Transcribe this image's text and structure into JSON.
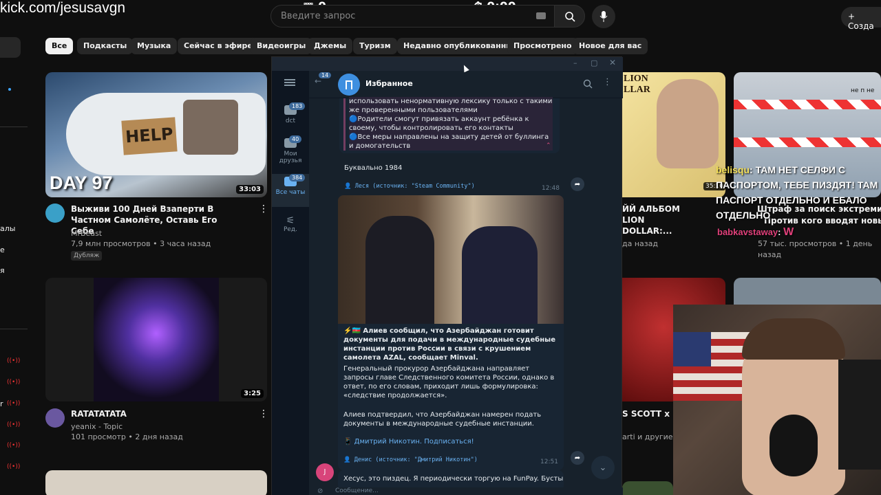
{
  "overlay": {
    "url": "kick.com/jesusavgn",
    "viewer_count": "0",
    "timer": "0:00"
  },
  "header": {
    "search_placeholder": "Введите запрос",
    "create_label": "Созда"
  },
  "chips": [
    "Все",
    "Подкасты",
    "Музыка",
    "Сейчас в эфире",
    "Видеоигры",
    "Джемы",
    "Туризм",
    "Недавно опубликованные",
    "Просмотрено",
    "Новое для вас"
  ],
  "sidebar_fragments": [
    "алы",
    "е",
    "я",
    "r"
  ],
  "videos": [
    {
      "thumb_text": "DAY 97",
      "thumb_sign": "HELP",
      "duration": "33:03",
      "title": "Выживи 100 Дней Взаперти В Частном Самолёте, Оставь Его Себе",
      "channel": "MrBeast",
      "stats": "7,9 млн просмотров • 3 часа назад",
      "badge": "Дубляж"
    },
    {
      "duration": "3:25",
      "title": "RATATATATA",
      "channel": "yeanix - Topic",
      "stats": "101 просмотр • 2 дня назад"
    },
    {
      "title": "ЙЙ АЛЬБОМ LION DOLLAR:...",
      "stats": "да назад",
      "thumb_text": "LION LLAR"
    },
    {
      "title": "Штраф за поиск экстремистс",
      "subtitle": "Против кого вводят новый за",
      "stats": "57 тыс. просмотров • 1 день назад",
      "duration": "35:10",
      "thumb_text": "не п не"
    },
    {
      "title": "S SCOTT x DR",
      "stats": "arti и другие ис"
    }
  ],
  "telegram": {
    "back_count": "14",
    "chat_title": "Избранное",
    "folders": [
      {
        "label": "dct",
        "count": "183"
      },
      {
        "label": "Мои друзья",
        "count": "40"
      },
      {
        "label": "Все чаты",
        "count": "384"
      },
      {
        "label": "Ред.",
        "count": ""
      }
    ],
    "msg1_lines": [
      "использовать ненормативную лексику только с такими же проверенными пользователями",
      "🔵Родители смогут привязать аккаунт ребёнка к своему, чтобы контролировать его контакты",
      "🔵Все меры направлены на защиту детей от буллинга и домогательств"
    ],
    "msg2_text": "Буквально 1984",
    "msg2_source": "👤 Леся (источник: \"Steam Community\")",
    "msg2_time": "12:48",
    "msg3_headline": "⚡️🇦🇿 Алиев сообщил, что Азербайджан готовит документы для подачи в международные судебные инстанции против России в связи с крушением самолета AZAL, сообщает Minval.",
    "msg3_p1": "Генеральный прокурор Азербайджана направляет запросы главе Следственного комитета России, однако в ответ, по его словам, приходит лишь формулировка: «следствие продолжается».",
    "msg3_p2": "Алиев подтвердил, что Азербайджан намерен подать документы в международные судебные инстанции.",
    "msg3_link": "📱 Дмитрий Никотин. Подписаться!",
    "msg3_source": "👤 Денис (источник: \"Дмитрий Никотин\")",
    "msg3_time": "12:51",
    "msg4_avatar": "J",
    "msg4_text": "Хесус, это пиздец. Я периодически торгую на FunPay. Бусты",
    "input_placeholder": "Сообщение..."
  },
  "stream_chat": [
    {
      "user": "belisqu",
      "text": "ТАМ НЕТ СЕЛФИ С ПАСПОРТОМ, ТЕБЕ ПИЗДЯТ! ТАМ ПАСПОРТ ОТДЕЛЬНО И ЕБАЛО ОТДЕЛЬНО"
    },
    {
      "user": "babkavstaway",
      "text": "W"
    }
  ]
}
